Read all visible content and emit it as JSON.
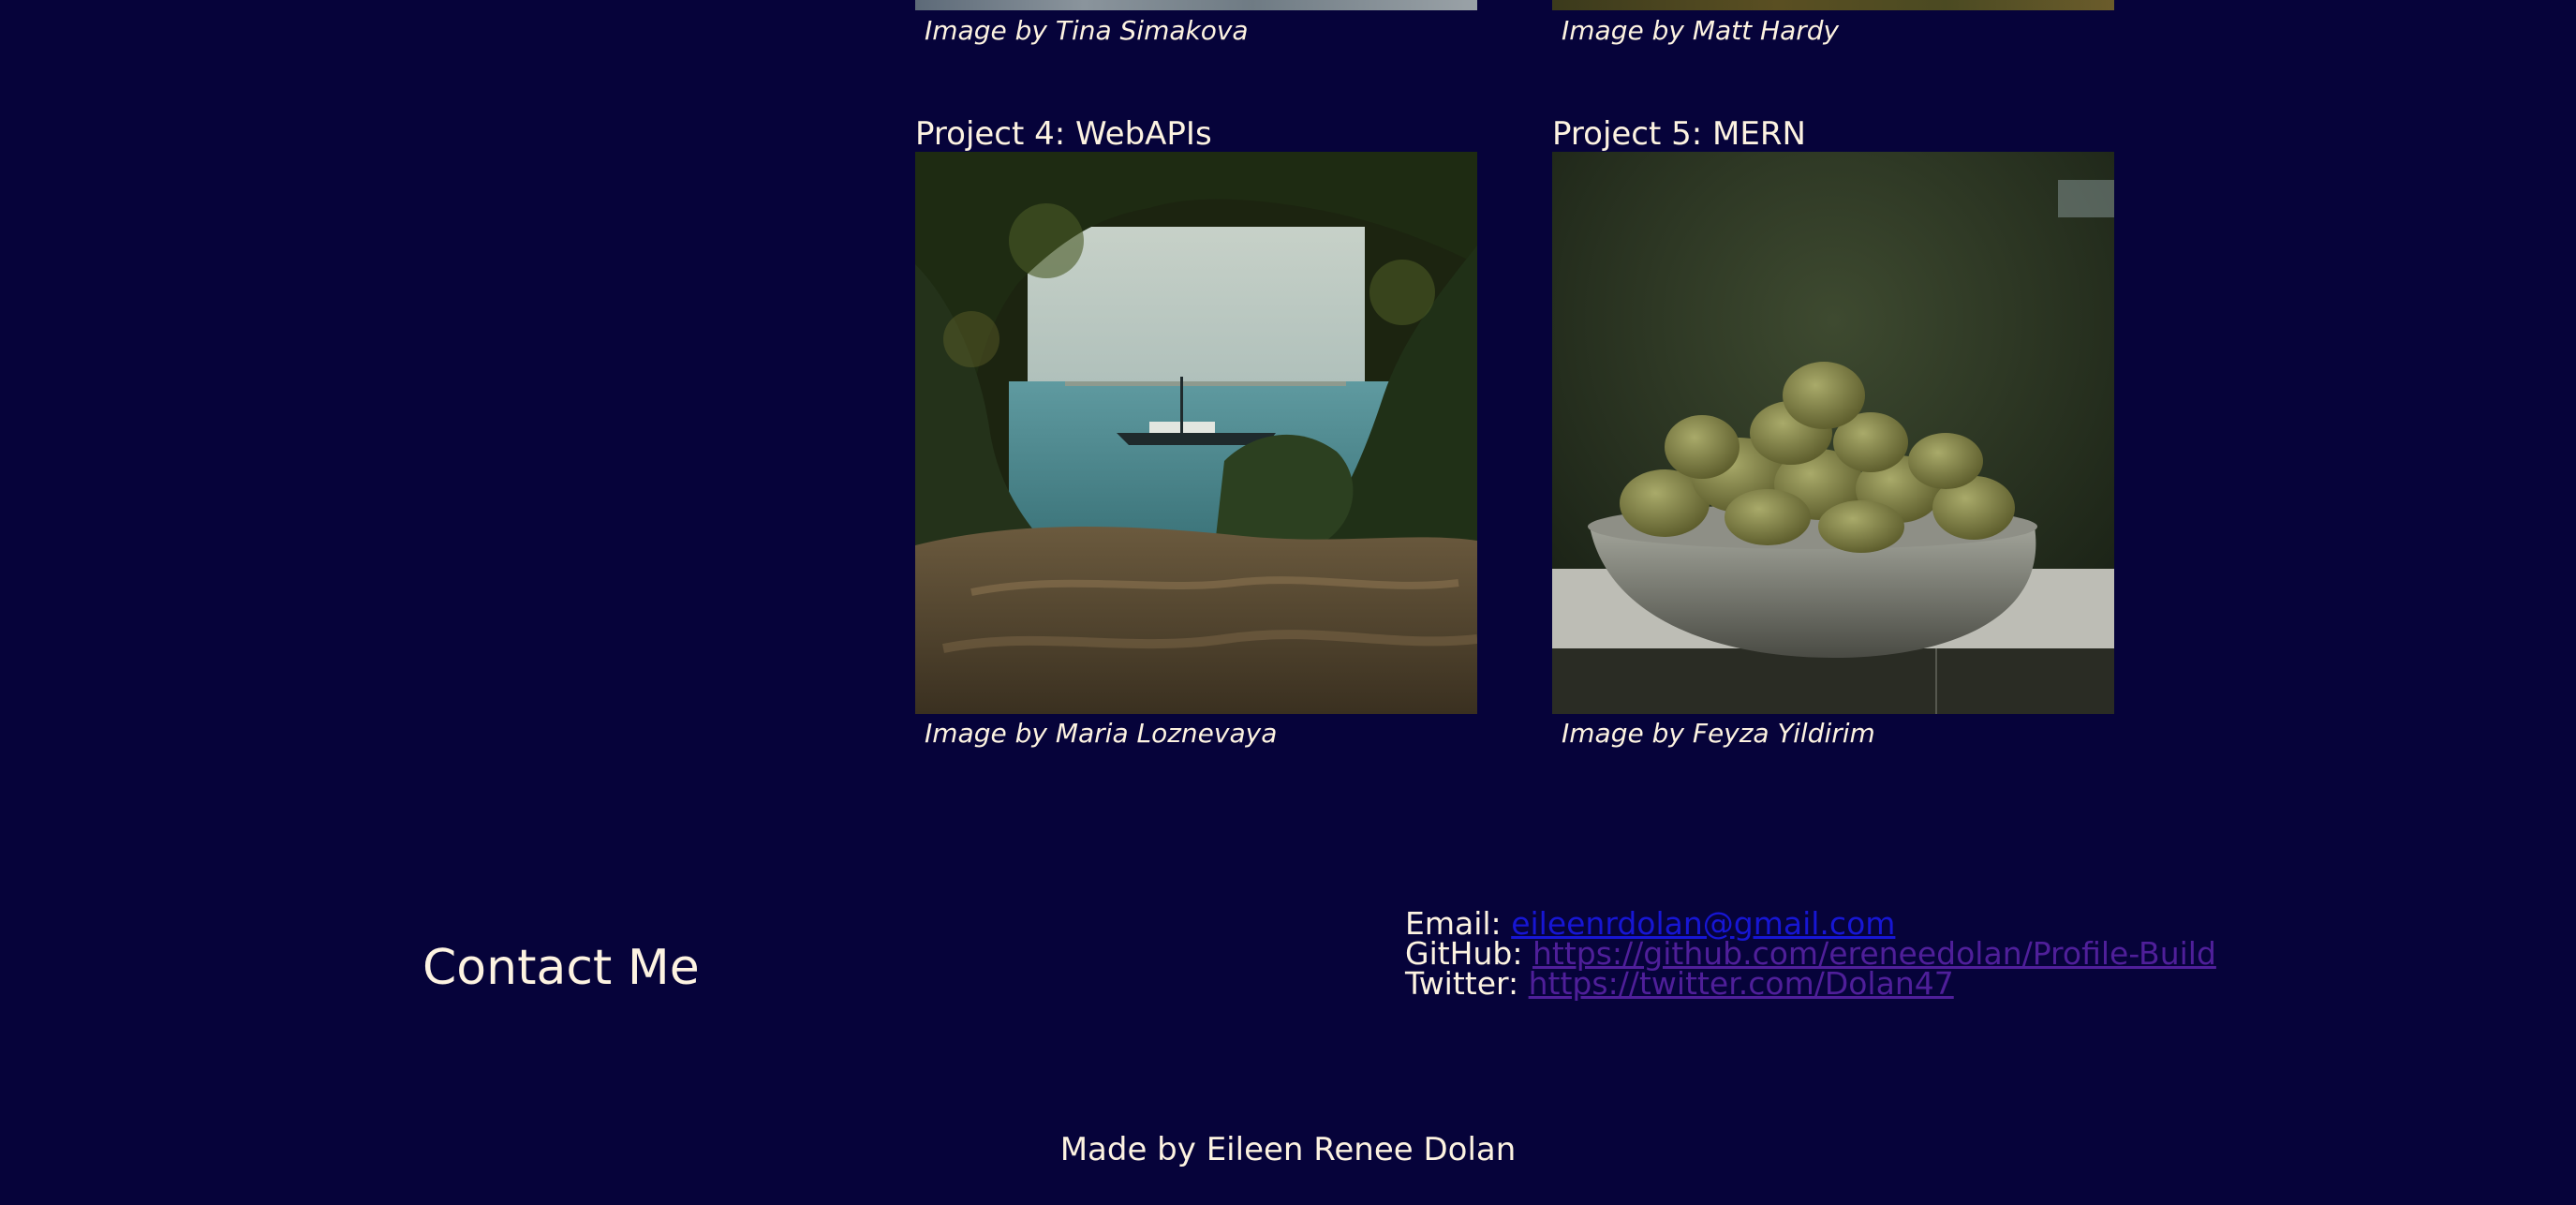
{
  "gallery": {
    "top_row": [
      {
        "caption": "Image by Tina Simakova"
      },
      {
        "caption": "Image by Matt Hardy"
      }
    ],
    "projects": [
      {
        "title": "Project 4: WebAPIs",
        "caption": "Image by Maria Loznevaya"
      },
      {
        "title": "Project 5: MERN",
        "caption": "Image by Feyza Yildirim"
      }
    ]
  },
  "contact": {
    "heading": "Contact Me",
    "email_label": "Email:",
    "email_link": "eileenrdolan@gmail.com",
    "github_label": "GitHub:",
    "github_link": "https://github.com/ereneedolan/Profile-Build",
    "twitter_label": "Twitter:",
    "twitter_link": "https://twitter.com/Dolan47"
  },
  "footer": {
    "text": "Made by Eileen Renee Dolan"
  }
}
